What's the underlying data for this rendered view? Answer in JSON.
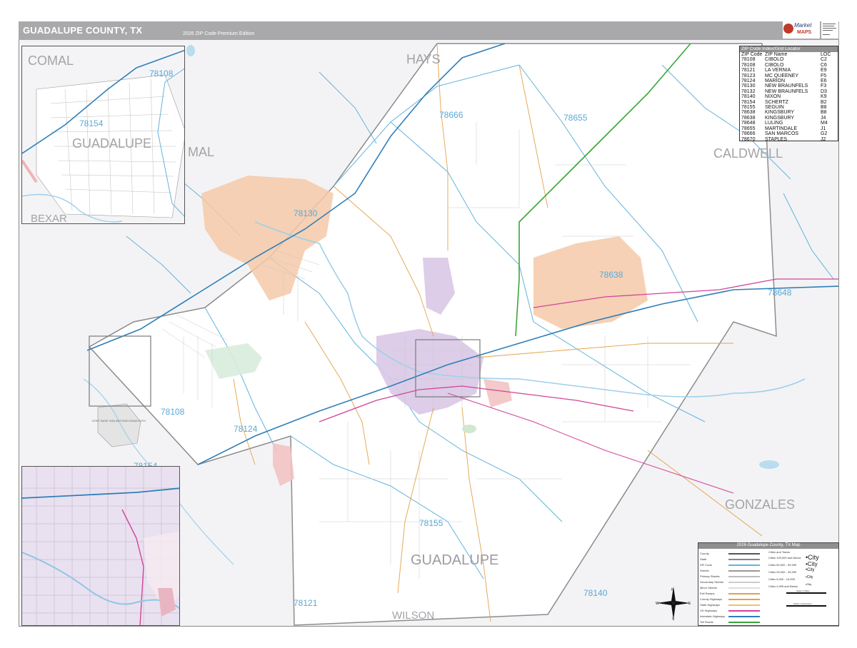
{
  "title": "GUADALUPE COUNTY, TX",
  "edition": "2026 ZIP Code Premium Edition",
  "logo": {
    "text_a": "Market",
    "text_b": "MAPS"
  },
  "colors": {
    "background": "#f3f3f5",
    "county_fill": "#ffffff",
    "zip_boundary": "#63b3dd",
    "county_boundary": "#8c8c8c",
    "interstate": "#2f7fb8",
    "us_highway": "#d2449a",
    "state_highway": "#e3a24a",
    "toll_road": "#3aa63a",
    "city_large": "#f5c9a8",
    "city_mid": "#d9c8e6",
    "city_small": "#f3c3c3",
    "water": "#b9dcef"
  },
  "county_labels": [
    "COMAL",
    "HAYS",
    "CALDWELL",
    "GONZALES",
    "WILSON",
    "GUADALUPE",
    "BEXAR",
    "MAL"
  ],
  "zip_labels": [
    "78108",
    "78154",
    "78666",
    "78655",
    "78130",
    "78638",
    "78648",
    "78124",
    "78155",
    "78121",
    "78140",
    "78108",
    "78154"
  ],
  "inset_a_labels": {
    "county_a": "COMAL",
    "county_b": "GUADALUPE",
    "county_c": "BEXAR",
    "zip_a": "78108",
    "zip_b": "78154"
  },
  "base_label": "JOINT BASE SAN ANTONIO-RANDOLPH",
  "zip_index": {
    "header": "ZIP Code Index/Grid Locator",
    "columns": [
      "ZIP Code",
      "ZIP Name",
      "LOC"
    ],
    "rows": [
      [
        "78108",
        "CIBOLO",
        "C2"
      ],
      [
        "78108",
        "CIBOLO",
        "C6"
      ],
      [
        "78121",
        "LA VERNIA",
        "E9"
      ],
      [
        "78123",
        "MC QUEENEY",
        "F5"
      ],
      [
        "78124",
        "MARION",
        "E6"
      ],
      [
        "78130",
        "NEW BRAUNFELS",
        "F3"
      ],
      [
        "78132",
        "NEW BRAUNFELS",
        "D3"
      ],
      [
        "78140",
        "NIXON",
        "K9"
      ],
      [
        "78154",
        "SCHERTZ",
        "B2"
      ],
      [
        "78155",
        "SEGUIN",
        "B8"
      ],
      [
        "78638",
        "KINGSBURY",
        "B8"
      ],
      [
        "78638",
        "KINGSBURY",
        "J4"
      ],
      [
        "78648",
        "LULING",
        "M4"
      ],
      [
        "78655",
        "MARTINDALE",
        "J1"
      ],
      [
        "78666",
        "SAN MARCOS",
        "G2"
      ],
      [
        "78670",
        "STAPLES",
        "J2"
      ]
    ]
  },
  "legend": {
    "header": "2026 Guadalupe County, TX Map",
    "line_items": [
      "County",
      "State",
      "ZIP Code",
      "Streets",
      "Primary Streets",
      "Secondary Streets",
      "Minor Streets",
      "Exit Ramps",
      "County Highways",
      "State Highways",
      "US Highways",
      "Interstate Highways",
      "Toll Roads"
    ],
    "city_header": "Cities and Towns",
    "city_items": [
      "Cities 100,000 and Above",
      "Cities 50,000 - 99,999",
      "Cities 25,000 - 49,999",
      "Cities 5,000 - 24,999",
      "Cities 4,999 and Below"
    ],
    "city_names": [
      "•City",
      "•City",
      "•City",
      "•City",
      "•City"
    ]
  },
  "compass": {
    "n": "N",
    "s": "S",
    "e": "E",
    "w": "W"
  },
  "scale": {
    "miles": "Scale in Miles",
    "km": "Scale in Kilometers"
  }
}
